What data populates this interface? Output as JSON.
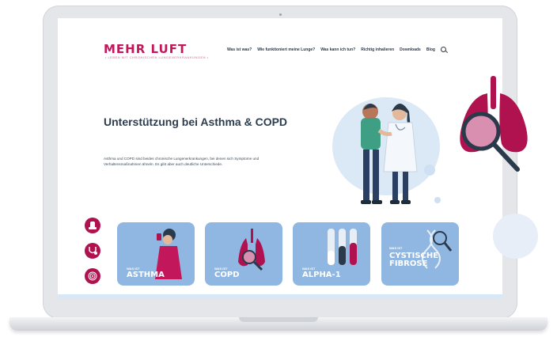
{
  "site": {
    "logo": "MEHR LUFT",
    "tagline": "• LEBEN MIT CHRONISCHEN LUNGENERKRANKUNGEN •"
  },
  "nav": {
    "items": [
      {
        "label": "Was ist was?"
      },
      {
        "label": "Wie funktioniert meine Lunge?"
      },
      {
        "label": "Was kann ich tun?"
      },
      {
        "label": "Richtig inhalieren"
      },
      {
        "label": "Downloads"
      },
      {
        "label": "Blog"
      }
    ],
    "search_icon": "search-icon"
  },
  "hero": {
    "title": "Unterstützung bei Asthma & COPD",
    "text": "Asthma und COPD sind beides chronische Lungenerkrankungen, bei denen sich Symptome und Verhaltensmaßnahmen ähneln. Es gibt aber auch deutliche Unterschiede."
  },
  "cards": [
    {
      "small": "WAS IST",
      "big": "ASTHMA"
    },
    {
      "small": "WAS IST",
      "big": "COPD"
    },
    {
      "small": "WAS IST",
      "big": "ALPHA-1"
    },
    {
      "small": "WAS IST",
      "big": "CYSTISCHE FIBROSE"
    }
  ],
  "side_icons": [
    "inhaler-icon",
    "stethoscope-icon",
    "fingerprint-icon"
  ],
  "colors": {
    "brand": "#b0124f",
    "card": "#8fb7e2",
    "heading": "#2d3d4e"
  }
}
